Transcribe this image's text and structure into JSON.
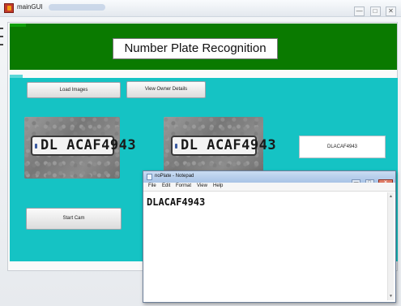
{
  "window": {
    "title": "mainGUI",
    "controls": [
      "—",
      "□",
      "✕"
    ]
  },
  "banner": {
    "title": "Number Plate Recognition",
    "color": "#0a7a00"
  },
  "panel": {
    "color": "#15c3c4"
  },
  "buttons": {
    "load_images": "Load Images",
    "view_owner": "View Owner Details",
    "start_cam": "Start Cam"
  },
  "plates": [
    {
      "text": "DL ACAF4943"
    },
    {
      "text": "DL ACAF4943"
    }
  ],
  "result": {
    "value": "DLACAF4943"
  },
  "notepad": {
    "title": "noPlate - Notepad",
    "menu": [
      "File",
      "Edit",
      "Format",
      "View",
      "Help"
    ],
    "content": "DLACAF4943",
    "controls": [
      "—",
      "□",
      "✕"
    ]
  }
}
